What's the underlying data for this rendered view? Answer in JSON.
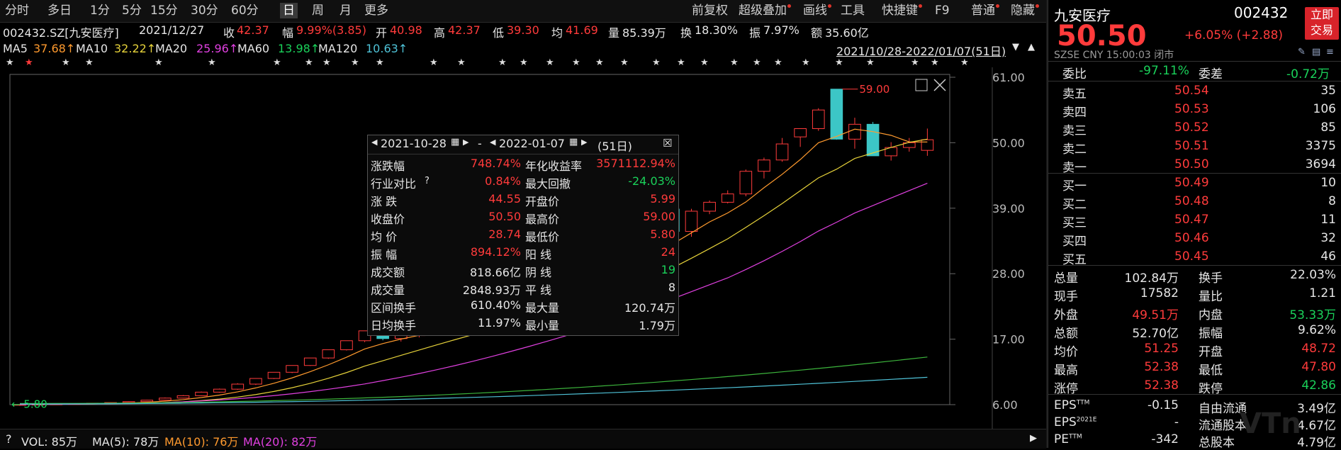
{
  "toolbar": {
    "items": [
      "分时",
      "多日",
      "1分",
      "5分",
      "15分",
      "30分",
      "60分",
      "日",
      "周",
      "月",
      "更多"
    ],
    "active": "日",
    "right_items": [
      "前复权",
      "超级叠加",
      "画线",
      "工具",
      "快捷键",
      "F9",
      "普通",
      "隐藏"
    ]
  },
  "info": {
    "code": "002432.SZ[九安医疗]",
    "date": "2021/12/27",
    "close_label": "收",
    "close": "42.37",
    "amp_label": "幅",
    "amp": "9.99%(3.85)",
    "open_label": "开",
    "open": "40.98",
    "high_label": "高",
    "high": "42.37",
    "low_label": "低",
    "low": "39.30",
    "avg_label": "均",
    "avg": "41.69",
    "vol_label": "量",
    "vol": "85.39万",
    "turn_label": "换",
    "turn": "18.30%",
    "zf_label": "振",
    "zf": "7.97%",
    "amt_label": "额",
    "amt": "35.60亿"
  },
  "ma": {
    "ma5_label": "MA5",
    "ma5": "37.68↑",
    "ma10_label": "MA10",
    "ma10": "32.22↑",
    "ma20_label": "MA20",
    "ma20": "25.96↑",
    "ma60_label": "MA60",
    "ma60": "13.98↑",
    "ma120_label": "MA120",
    "ma120": "10.63↑",
    "range": "2021/10/28-2022/01/07(51日)"
  },
  "colors": {
    "up": "#ff3b3b",
    "down": "#3cc6c6",
    "ma5": "#ffffff",
    "ma10": "#e6d23a",
    "ma20": "#e040e0",
    "ma60": "#3cb43c",
    "ma120": "#4fc3d8"
  },
  "chart_data": {
    "type": "candlestick",
    "y_ticks": [
      "61.00",
      "50.00",
      "39.00",
      "28.00",
      "17.00",
      "6.00"
    ],
    "ylim": [
      6.0,
      61.0
    ],
    "high_marker": "59.00",
    "low_marker": "5.80",
    "candles": [
      [
        5.99,
        6.05,
        5.8,
        6.02
      ],
      [
        6.02,
        6.1,
        5.95,
        6.06
      ],
      [
        6.06,
        6.15,
        6.0,
        6.1
      ],
      [
        6.1,
        6.2,
        6.05,
        6.15
      ],
      [
        6.15,
        6.3,
        6.1,
        6.25
      ],
      [
        6.25,
        6.4,
        6.2,
        6.35
      ],
      [
        6.35,
        6.55,
        6.3,
        6.5
      ],
      [
        6.5,
        6.8,
        6.45,
        6.75
      ],
      [
        6.75,
        7.2,
        6.7,
        7.1
      ],
      [
        7.1,
        7.6,
        7.05,
        7.5
      ],
      [
        7.5,
        8.2,
        7.45,
        8.1
      ],
      [
        8.1,
        8.7,
        8.0,
        8.6
      ],
      [
        8.6,
        9.6,
        8.5,
        9.45
      ],
      [
        9.45,
        10.4,
        9.3,
        10.4
      ],
      [
        10.4,
        11.44,
        10.3,
        11.44
      ],
      [
        11.44,
        12.58,
        11.3,
        12.58
      ],
      [
        12.58,
        13.84,
        12.5,
        13.84
      ],
      [
        13.84,
        15.22,
        13.7,
        15.22
      ],
      [
        15.22,
        16.74,
        15.1,
        16.74
      ],
      [
        16.74,
        18.4,
        16.5,
        18.4
      ],
      [
        18.4,
        19.2,
        16.8,
        17.1
      ],
      [
        17.1,
        17.8,
        16.6,
        17.6
      ],
      [
        17.6,
        18.7,
        17.3,
        18.4
      ],
      [
        18.4,
        19.5,
        18.1,
        19.3
      ],
      [
        19.3,
        20.4,
        19.0,
        20.2
      ],
      [
        20.2,
        21.3,
        19.9,
        21.1
      ],
      [
        21.1,
        22.3,
        20.8,
        22.0
      ],
      [
        22.0,
        23.2,
        21.7,
        22.9
      ],
      [
        22.9,
        24.1,
        22.6,
        23.8
      ],
      [
        23.8,
        25.2,
        23.5,
        24.9
      ],
      [
        24.9,
        26.3,
        24.6,
        26.0
      ],
      [
        26.0,
        27.8,
        25.8,
        27.5
      ],
      [
        27.5,
        29.6,
        27.3,
        29.4
      ],
      [
        29.4,
        31.2,
        29.0,
        30.8
      ],
      [
        30.8,
        33.9,
        30.5,
        33.9
      ],
      [
        33.9,
        36.0,
        30.5,
        36.0
      ],
      [
        38.85,
        40.2,
        37.8,
        35.1
      ],
      [
        35.1,
        38.9,
        34.2,
        38.5
      ],
      [
        38.5,
        40.3,
        38.0,
        40.0
      ],
      [
        40.0,
        42.0,
        39.8,
        41.4
      ],
      [
        41.4,
        45.5,
        41.0,
        45.2
      ],
      [
        45.2,
        47.5,
        44.0,
        47.1
      ],
      [
        47.1,
        50.8,
        46.8,
        49.8
      ],
      [
        50.98,
        52.37,
        49.3,
        52.37
      ],
      [
        52.37,
        55.8,
        52.0,
        55.5
      ],
      [
        59.0,
        59.0,
        50.5,
        50.6
      ],
      [
        50.6,
        54.2,
        49.0,
        53.1
      ],
      [
        53.1,
        53.5,
        47.8,
        47.8
      ],
      [
        47.8,
        50.1,
        47.0,
        49.2
      ],
      [
        49.2,
        50.8,
        48.5,
        50.0
      ],
      [
        48.72,
        52.38,
        47.8,
        50.5
      ]
    ]
  },
  "stats": {
    "start": "2021-10-28",
    "end": "2022-01-07",
    "dash": "-",
    "days": "(51日)",
    "rows": [
      {
        "l1": "涨跌幅",
        "v1": "748.74%",
        "c1": "red",
        "l2": "年化收益率",
        "v2": "3571112.94%",
        "c2": "red"
      },
      {
        "l1": "行业对比",
        "v1": "0.84%",
        "c1": "red",
        "l2": "最大回撤",
        "v2": "-24.03%",
        "c2": "green"
      },
      {
        "l1": "涨  跌",
        "v1": "44.55",
        "c1": "red",
        "l2": "开盘价",
        "v2": "5.99",
        "c2": "red"
      },
      {
        "l1": "收盘价",
        "v1": "50.50",
        "c1": "red",
        "l2": "最高价",
        "v2": "59.00",
        "c2": "red"
      },
      {
        "l1": "均  价",
        "v1": "28.74",
        "c1": "red",
        "l2": "最低价",
        "v2": "5.80",
        "c2": "red"
      },
      {
        "l1": "振  幅",
        "v1": "894.12%",
        "c1": "red",
        "l2": "阳  线",
        "v2": "24",
        "c2": "red"
      },
      {
        "l1": "成交额",
        "v1": "818.66亿",
        "c1": "white",
        "l2": "阴  线",
        "v2": "19",
        "c2": "green"
      },
      {
        "l1": "成交量",
        "v1": "2848.93万",
        "c1": "white",
        "l2": "平  线",
        "v2": "8",
        "c2": "white"
      },
      {
        "l1": "区间换手",
        "v1": "610.40%",
        "c1": "white",
        "l2": "最大量",
        "v2": "120.74万",
        "c2": "white"
      },
      {
        "l1": "日均换手",
        "v1": "11.97%",
        "c1": "white",
        "l2": "最小量",
        "v2": "1.79万",
        "c2": "white"
      }
    ]
  },
  "bottom": {
    "q": "?",
    "vol_label": "VOL: 85万",
    "ma5": "MA(5): 78万",
    "ma10": "MA(10): 76万",
    "ma20": "MA(20): 82万"
  },
  "panel": {
    "name": "九安医疗",
    "code": "002432",
    "price": "50.50",
    "change": "+6.05% (+2.88)",
    "trade_btn1": "立即",
    "trade_btn2": "交易",
    "market": "SZSE  CNY  15:00:03 闭市",
    "weibi_label": "委比",
    "weibi": "-97.11%",
    "weicha_label": "委差",
    "weicha": "-0.72万",
    "asks": [
      {
        "label": "卖五",
        "price": "50.54",
        "vol": "35"
      },
      {
        "label": "卖四",
        "price": "50.53",
        "vol": "106"
      },
      {
        "label": "卖三",
        "price": "50.52",
        "vol": "85"
      },
      {
        "label": "卖二",
        "price": "50.51",
        "vol": "3375"
      },
      {
        "label": "卖一",
        "price": "50.50",
        "vol": "3694"
      }
    ],
    "bids": [
      {
        "label": "买一",
        "price": "50.49",
        "vol": "10"
      },
      {
        "label": "买二",
        "price": "50.48",
        "vol": "8"
      },
      {
        "label": "买三",
        "price": "50.47",
        "vol": "11"
      },
      {
        "label": "买四",
        "price": "50.46",
        "vol": "32"
      },
      {
        "label": "买五",
        "price": "50.45",
        "vol": "46"
      }
    ],
    "quotes": [
      {
        "l1": "总量",
        "v1": "102.84万",
        "c1": "white",
        "l2": "换手",
        "v2": "22.03%",
        "c2": "white"
      },
      {
        "l1": "现手",
        "v1": "17582",
        "c1": "white",
        "l2": "量比",
        "v2": "1.21",
        "c2": "white"
      },
      {
        "l1": "外盘",
        "v1": "49.51万",
        "c1": "red",
        "l2": "内盘",
        "v2": "53.33万",
        "c2": "green"
      },
      {
        "l1": "总额",
        "v1": "52.70亿",
        "c1": "white",
        "l2": "振幅",
        "v2": "9.62%",
        "c2": "white"
      },
      {
        "l1": "均价",
        "v1": "51.25",
        "c1": "red",
        "l2": "开盘",
        "v2": "48.72",
        "c2": "red"
      },
      {
        "l1": "最高",
        "v1": "52.38",
        "c1": "red",
        "l2": "最低",
        "v2": "47.80",
        "c2": "red"
      },
      {
        "l1": "涨停",
        "v1": "52.38",
        "c1": "red",
        "l2": "跌停",
        "v2": "42.86",
        "c2": "green"
      }
    ],
    "fin": [
      {
        "l1": "EPS",
        "sup1": "TTM",
        "v1": "-0.15",
        "l2": "自由流通",
        "v2": "3.49亿"
      },
      {
        "l1": "EPS",
        "sup1": "2021E",
        "v1": "-",
        "l2": "流通股本",
        "v2": "4.67亿"
      },
      {
        "l1": "PE",
        "sup1": "TTM",
        "v1": "-342",
        "l2": "总股本",
        "v2": "4.79亿"
      }
    ]
  }
}
